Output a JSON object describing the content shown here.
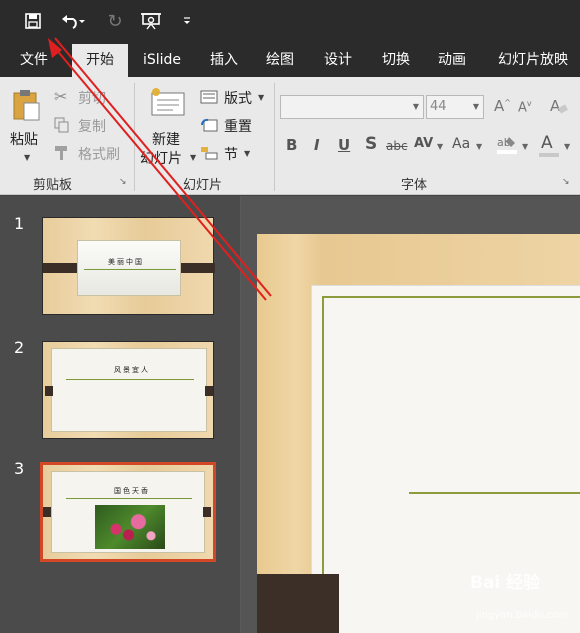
{
  "qat": {
    "redo_icon": "↻"
  },
  "tabs": [
    "文件",
    "开始",
    "iSlide",
    "插入",
    "绘图",
    "设计",
    "切换",
    "动画",
    "幻灯片放映"
  ],
  "ribbon": {
    "clipboard": {
      "paste": "粘贴",
      "cut": "剪切",
      "copy": "复制",
      "format_painter": "格式刷",
      "group": "剪贴板"
    },
    "slides": {
      "new_slide_1": "新建",
      "new_slide_2": "幻灯片",
      "layout": "版式",
      "reset": "重置",
      "section": "节",
      "group": "幻灯片"
    },
    "font": {
      "font_name": "",
      "font_size": "44",
      "bold": "B",
      "italic": "I",
      "underline": "U",
      "shadow": "S",
      "strike": "abc",
      "spacing": "AV",
      "case": "Aa",
      "clear": "A",
      "grow": "A",
      "shrink": "A",
      "color": "A",
      "group": "字体"
    }
  },
  "slides_panel": [
    {
      "num": "1",
      "title": "美丽中国"
    },
    {
      "num": "2",
      "title": "风景宜人"
    },
    {
      "num": "3",
      "title": "国色天香"
    }
  ],
  "watermark": {
    "logo": "Bai 经验",
    "url": "jingyan.baidu.com"
  },
  "colors": {
    "accent": "#d24726",
    "slide_border": "#8a9c3b",
    "annotation": "#e02020"
  }
}
